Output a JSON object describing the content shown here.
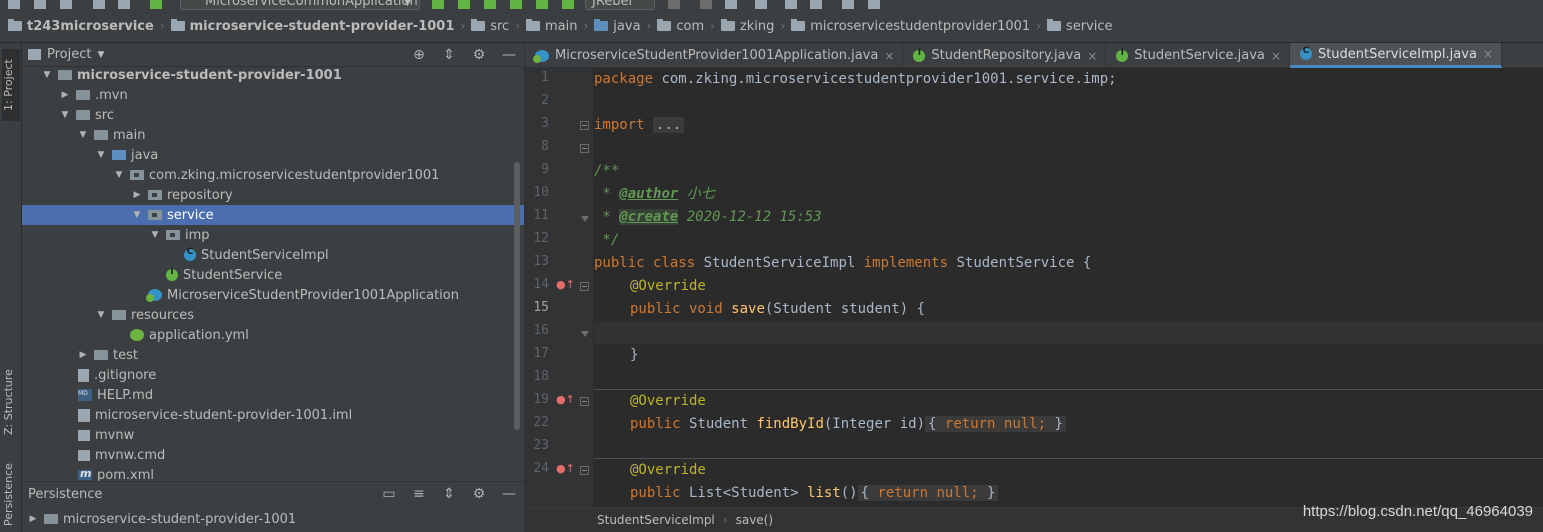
{
  "toolbar": {
    "run_config": "MicroserviceCommonApplication",
    "jrebel": "JRebel"
  },
  "navbar": {
    "crumbs": [
      "t243microservice",
      "microservice-student-provider-1001",
      "src",
      "main",
      "java",
      "com",
      "zking",
      "microservicestudentprovider1001",
      "service"
    ]
  },
  "left_stripe": {
    "project": "1: Project",
    "structure": "Z: Structure",
    "persistence": "Persistence"
  },
  "project_panel": {
    "title": "Project",
    "tree": [
      {
        "label": "microservice-student-provider-1001",
        "bold": true
      },
      {
        "label": ".mvn"
      },
      {
        "label": "src"
      },
      {
        "label": "main"
      },
      {
        "label": "java"
      },
      {
        "label": "com.zking.microservicestudentprovider1001"
      },
      {
        "label": "repository"
      },
      {
        "label": "service",
        "selected": true
      },
      {
        "label": "imp"
      },
      {
        "label": "StudentServiceImpl"
      },
      {
        "label": "StudentService"
      },
      {
        "label": "MicroserviceStudentProvider1001Application"
      },
      {
        "label": "resources"
      },
      {
        "label": "application.yml"
      },
      {
        "label": "test"
      },
      {
        "label": ".gitignore"
      },
      {
        "label": "HELP.md"
      },
      {
        "label": "microservice-student-provider-1001.iml"
      },
      {
        "label": "mvnw"
      },
      {
        "label": "mvnw.cmd"
      },
      {
        "label": "pom.xml"
      }
    ]
  },
  "persistence_panel": {
    "title": "Persistence",
    "item": "microservice-student-provider-1001"
  },
  "editor": {
    "tabs": [
      {
        "label": "MicroserviceStudentProvider1001Application.java"
      },
      {
        "label": "StudentRepository.java"
      },
      {
        "label": "StudentService.java"
      },
      {
        "label": "StudentServiceImpl.java",
        "active": true
      }
    ],
    "line_numbers": [
      "1",
      "2",
      "3",
      "8",
      "9",
      "10",
      "11",
      "12",
      "13",
      "14",
      "15",
      "16",
      "17",
      "18",
      "19",
      "22",
      "23",
      "24"
    ],
    "code": {
      "l1_kw": "package",
      "l1_rest": " com.zking.microservicestudentprovider1001.service.imp;",
      "l3_kw": "import",
      "l3_fold": "...",
      "l8": "/**",
      "l9_star": " * ",
      "l9_tag": "@author",
      "l9_val": " 小七",
      "l10_star": " * ",
      "l10_tag": "@create",
      "l10_val": " 2020-12-12 15:53",
      "l11": " */",
      "l12_kw": "public class",
      "l12_name": " StudentServiceImpl ",
      "l12_kw2": "implements",
      "l12_rest": " StudentService {",
      "l13": "@Override",
      "l14_kw": "public void",
      "l14_fn": "save",
      "l14_rest": "(Student student) {",
      "l16": "}",
      "l18": "@Override",
      "l19_kw": "public",
      "l19_type": " Student ",
      "l19_fn": "findById",
      "l19_params": "(Integer id)",
      "l19_open": "{ ",
      "l19_ret": "return null;",
      "l19_close": " }",
      "l23": "@Override",
      "l24_kw": "public",
      "l24_type": " List<Student> ",
      "l24_fn": "list",
      "l24_params": "()",
      "l24_open": "{ ",
      "l24_ret": "return null;",
      "l24_close": " }"
    },
    "bottom_crumbs": [
      "StudentServiceImpl",
      "save()"
    ]
  },
  "watermark": "https://blog.csdn.net/qq_46964039"
}
